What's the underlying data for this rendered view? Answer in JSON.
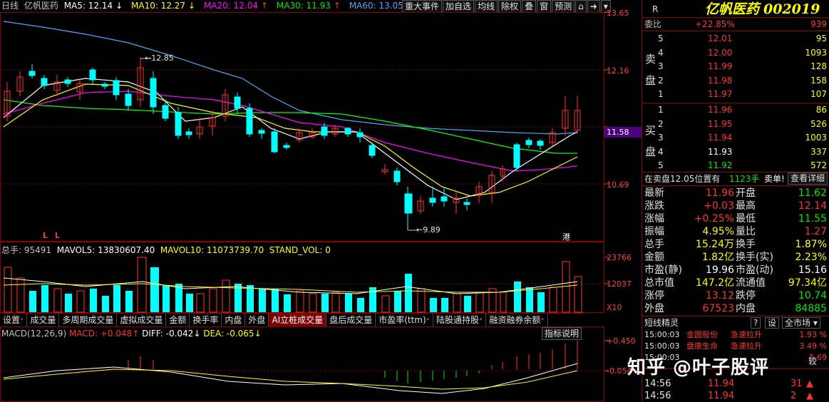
{
  "header": {
    "period": "日线",
    "stock_name": "亿帆医药",
    "ma5": "MA5: 12.14",
    "ma10": "MA10: 12.27",
    "ma20": "MA20: 12.04",
    "ma30": "MA30: 11.93",
    "ma60": "MA60: 13.05",
    "ma5_arrow": "↓",
    "ma10_arrow": "↓",
    "ma20_arrow": "↑",
    "ma30_arrow": "↑",
    "ma60_arrow": "↓"
  },
  "toolbar": {
    "buttons": [
      "重大事件",
      "加自选",
      "均线",
      "除权",
      "叠",
      "窗",
      "预测"
    ]
  },
  "price_axis": {
    "labels": [
      "13.65",
      "12.16",
      "11.58",
      "10.69"
    ],
    "current_price_tag": "11.58",
    "high_marker": "12.85",
    "low_marker": "9.89",
    "l_marks": [
      "L",
      "L"
    ],
    "hk_mark": "港"
  },
  "colors": {
    "up": "#ff3232",
    "down": "#00ffff",
    "ma5": "#ffffff",
    "ma10": "#ffff00",
    "ma20": "#ff00ff",
    "ma30": "#00ff00",
    "ma60": "#4fa3ff",
    "border": "#8b0000"
  },
  "volume": {
    "legend_total": "总手: 95491",
    "mavol5": "MAVOL5: 13830607.40",
    "mavol10": "MAVOL10: 11073739.70",
    "stand_vol": "STAND_VOL: 0",
    "axis": [
      "23766",
      "12037",
      "X10"
    ]
  },
  "tabs": [
    {
      "label": "设置",
      "dot": true
    },
    {
      "label": "成交量",
      "dot": false
    },
    {
      "label": "多周期成交量",
      "dot": false
    },
    {
      "label": "虚拟成交量",
      "dot": false
    },
    {
      "label": "金额",
      "dot": false
    },
    {
      "label": "换手率",
      "dot": false
    },
    {
      "label": "内盘",
      "dot": false
    },
    {
      "label": "外盘",
      "dot": false
    },
    {
      "label": "AI立桩成交量",
      "dot": false,
      "active": true
    },
    {
      "label": "盘后成交量",
      "dot": false
    },
    {
      "label": "市盈率(ttm)",
      "dot": true
    },
    {
      "label": "陆股通持股",
      "dot": true
    },
    {
      "label": "融资融券余额",
      "dot": true
    }
  ],
  "macd": {
    "title": "MACD(12,26,9)",
    "macd": "MACD: +0.048",
    "diff": "DIFF: -0.042",
    "dea": "DEA: -0.065",
    "macd_arrow": "↑",
    "diff_arrow": "↓",
    "dea_arrow": "↓",
    "indicator_button": "指标说明",
    "axis": [
      "+0.450",
      "-0.054"
    ]
  },
  "quote": {
    "r": "R",
    "name": "亿帆医药",
    "code": "002019",
    "weibi_label": "委比",
    "weibi_value": "+22.85%",
    "weibi_diff": "939",
    "sell_label": [
      "卖",
      "盘"
    ],
    "buy_label": [
      "买",
      "盘"
    ],
    "sells": [
      {
        "n": "5",
        "price": "12.01",
        "vol": "95"
      },
      {
        "n": "4",
        "price": "12.00",
        "vol": "1093"
      },
      {
        "n": "3",
        "price": "11.99",
        "vol": "128"
      },
      {
        "n": "2",
        "price": "11.98",
        "vol": "158"
      },
      {
        "n": "1",
        "price": "11.97",
        "vol": "107"
      }
    ],
    "buys": [
      {
        "n": "1",
        "price": "11.96",
        "vol": "86"
      },
      {
        "n": "2",
        "price": "11.95",
        "vol": "526"
      },
      {
        "n": "3",
        "price": "11.94",
        "vol": "1003"
      },
      {
        "n": "4",
        "price": "11.93",
        "vol": "337"
      },
      {
        "n": "5",
        "price": "11.92",
        "vol": "572"
      }
    ],
    "notice_left": "在卖盘12.05位置有",
    "notice_amt": "1123手",
    "notice_right": "卖单!",
    "notice_btn": "查看详细",
    "stats": [
      {
        "l1": "最新",
        "v1": "11.96",
        "c1": "red",
        "l2": "开盘",
        "v2": "11.62",
        "c2": "green"
      },
      {
        "l1": "涨跌",
        "v1": "+0.03",
        "c1": "red",
        "l2": "最高",
        "v2": "12.14",
        "c2": "red"
      },
      {
        "l1": "涨幅",
        "v1": "+0.25%",
        "c1": "red",
        "l2": "最低",
        "v2": "11.55",
        "c2": "green"
      },
      {
        "l1": "振幅",
        "v1": "4.95%",
        "c1": "yellow",
        "l2": "量比",
        "v2": "1.27",
        "c2": "red"
      },
      {
        "l1": "总手",
        "v1": "15.24万",
        "c1": "yellow",
        "l2": "换手",
        "v2": "1.87%",
        "c2": "yellow"
      },
      {
        "l1": "金额",
        "v1": "1.82亿",
        "c1": "yellow",
        "l2": "换手(实)",
        "v2": "2.23%",
        "c2": "yellow"
      },
      {
        "l1": "市盈(静)",
        "v1": "19.96",
        "c1": "white",
        "l2": "市盈(动)",
        "v2": "15.16",
        "c2": "white"
      },
      {
        "l1": "总市值",
        "v1": "147.2亿",
        "c1": "yellow",
        "l2": "流通值",
        "v2": "97.34亿",
        "c2": "yellow"
      },
      {
        "l1": "涨停",
        "v1": "13.12",
        "c1": "red",
        "l2": "跌停",
        "v2": "10.74",
        "c2": "green"
      },
      {
        "l1": "外盘",
        "v1": "67523",
        "c1": "red",
        "l2": "内盘",
        "v2": "84885",
        "c2": "green"
      }
    ],
    "short_title": "短线精灵",
    "short_icons": [
      "?",
      "设"
    ],
    "market_select": "全市场",
    "short_items": [
      {
        "time": "15:00:03",
        "name": "金圆股份",
        "event": "急速拉升",
        "pct": "1.93 %"
      },
      {
        "time": "15:00:03",
        "name": "盘康生命",
        "event": "急速拉升",
        "pct": "3.49 %"
      },
      {
        "time": "15:00:03",
        "name": "",
        "event": "",
        "pct": "5.69"
      }
    ],
    "short_item_extra": "较",
    "ticks": [
      {
        "time": "14:56",
        "price": "11.94",
        "vol": "31"
      },
      {
        "time": "14:56",
        "price": "11.94",
        "vol": "2"
      }
    ]
  },
  "watermark": "知乎 @叶子股评"
}
